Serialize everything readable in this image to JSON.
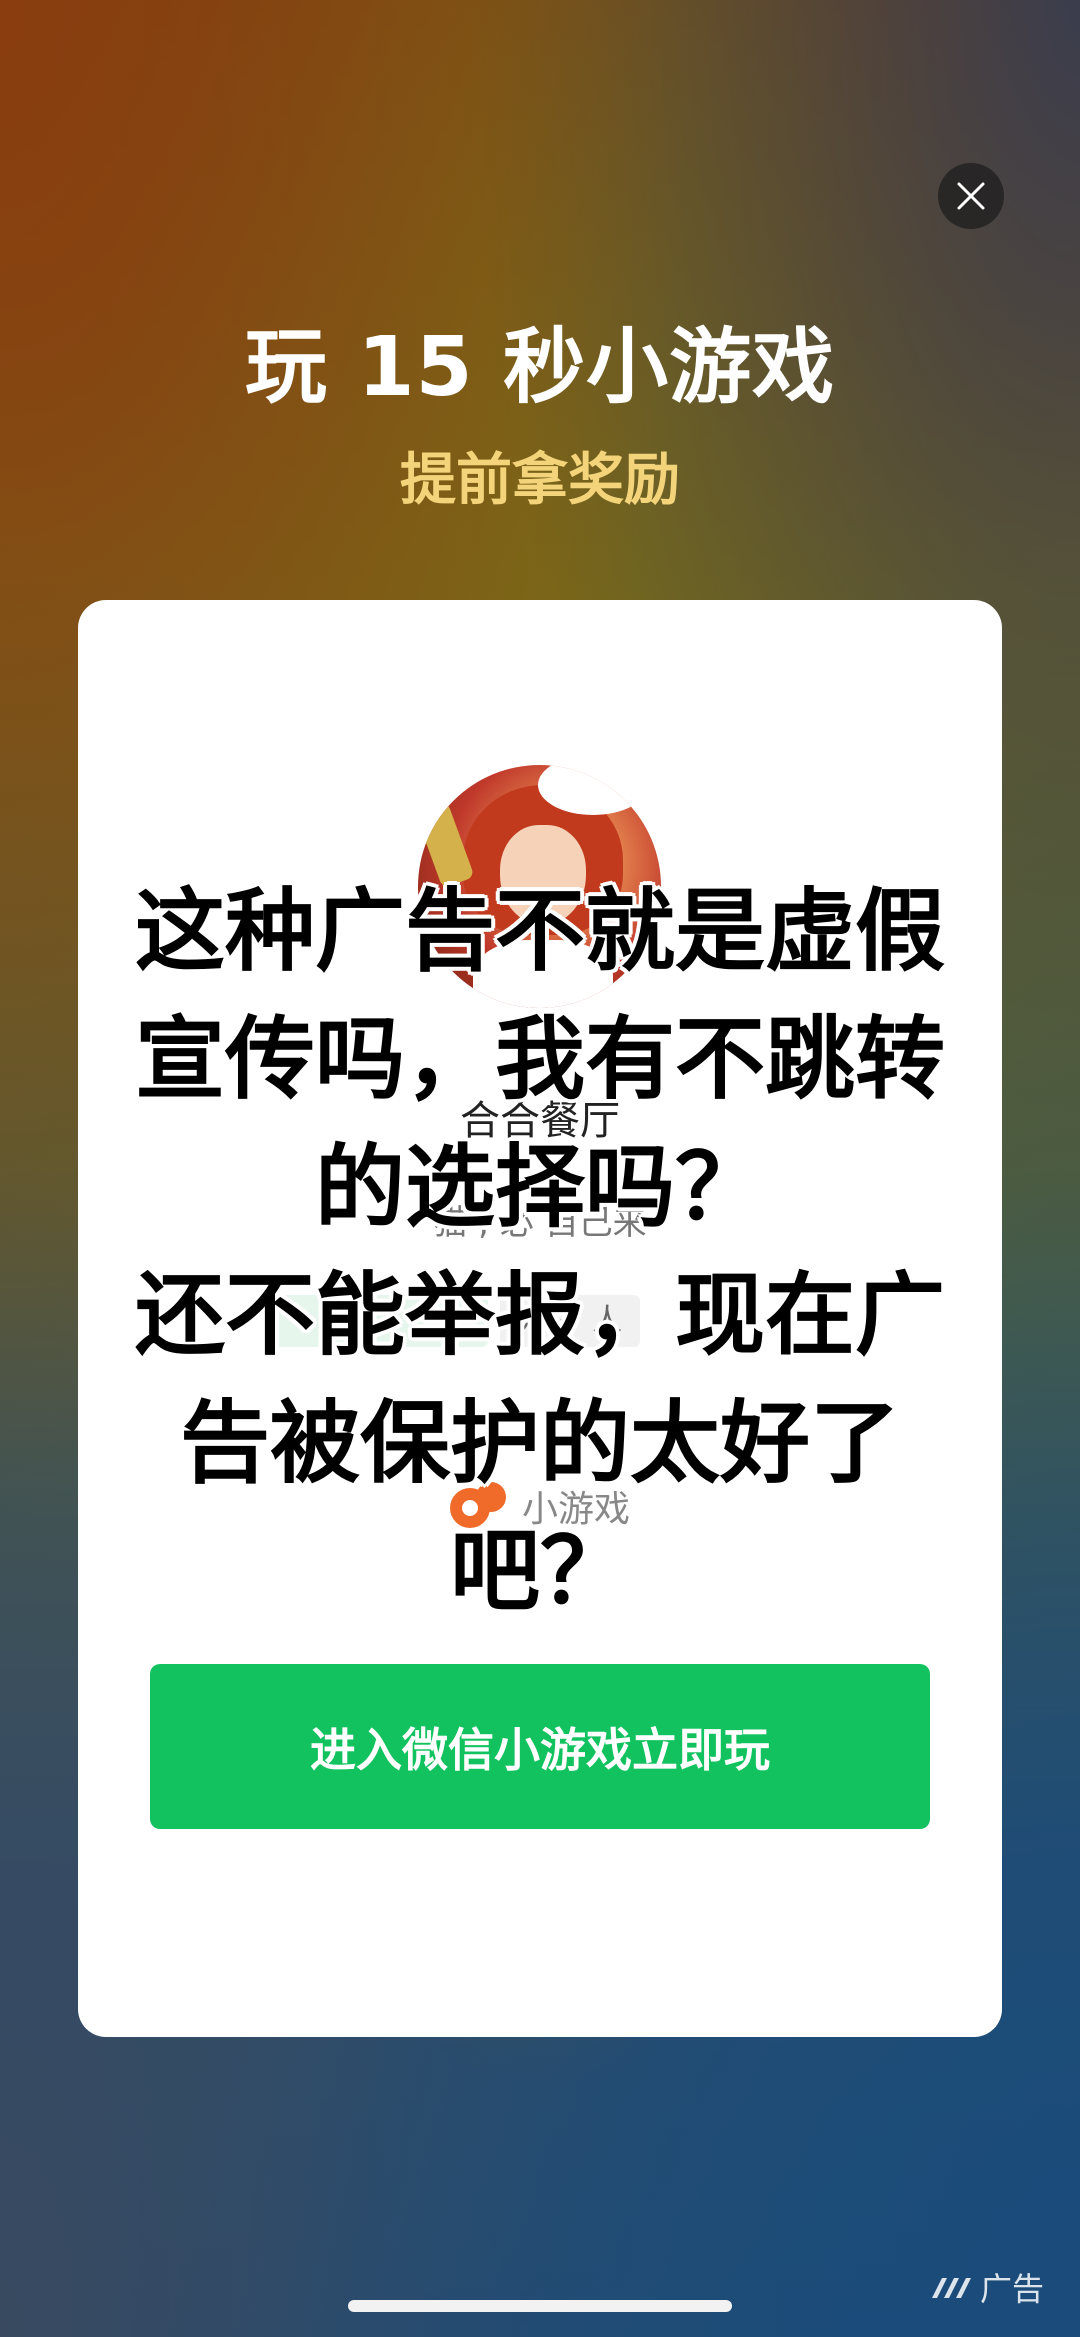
{
  "header": {
    "title": "玩 15 秒小游戏",
    "subtitle": "提前拿奖励"
  },
  "close": {
    "icon": "close-icon"
  },
  "card": {
    "game_name": "合合餐厅",
    "game_desc": "猫 , 必 自己来",
    "tag_label": "万 + 人",
    "mini_game_label": "小游戏",
    "cta_label": "进入微信小游戏立即玩"
  },
  "overlay": {
    "text": "这种广告不就是虚假\n宣传吗，我有不跳转\n的选择吗？\n还不能举报，现在广\n告被保护的太好了\n吧？"
  },
  "ad_badge": {
    "label": "广告"
  },
  "colors": {
    "cta_green": "#11c25e",
    "subtitle_gold": "#f4d47a"
  }
}
